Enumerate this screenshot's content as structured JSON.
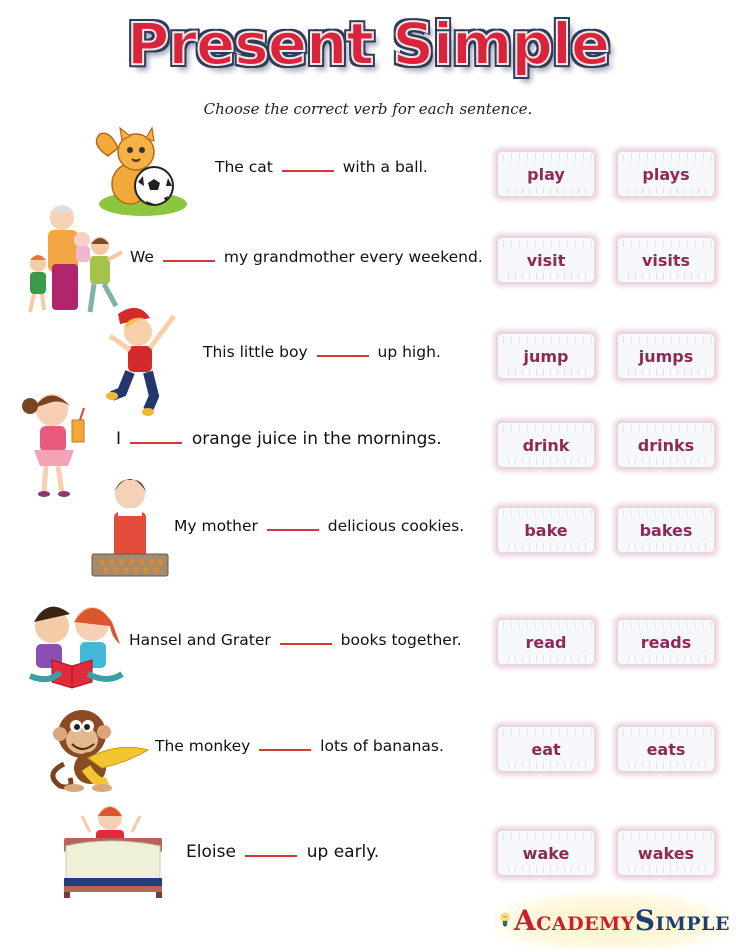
{
  "header": {
    "title": "Present Simple",
    "subtitle": "Choose the correct verb for each sentence."
  },
  "exercises": [
    {
      "before": "The cat",
      "after": "with a ball.",
      "options": [
        "play",
        "plays"
      ],
      "illustration": "cat-with-soccer-ball"
    },
    {
      "before": "We",
      "after": "my grandmother every weekend.",
      "options": [
        "visit",
        "visits"
      ],
      "illustration": "grandmother-with-children"
    },
    {
      "before": "This little boy",
      "after": "up high.",
      "options": [
        "jump",
        "jumps"
      ],
      "illustration": "boy-jumping"
    },
    {
      "before": "I",
      "after": "orange juice in the mornings.",
      "options": [
        "drink",
        "drinks"
      ],
      "illustration": "girl-drinking-juice"
    },
    {
      "before": "My mother",
      "after": "delicious cookies.",
      "options": [
        "bake",
        "bakes"
      ],
      "illustration": "mother-with-cookie-tray"
    },
    {
      "before": "Hansel and Grater",
      "after": "books together.",
      "options": [
        "read",
        "reads"
      ],
      "illustration": "children-reading-book"
    },
    {
      "before": "The monkey",
      "after": "lots of bananas.",
      "options": [
        "eat",
        "eats"
      ],
      "illustration": "monkey-with-banana"
    },
    {
      "before": "Eloise",
      "after": "up early.",
      "options": [
        "wake",
        "wakes"
      ],
      "illustration": "child-waking-in-bed"
    }
  ],
  "logo": {
    "part1_initial": "A",
    "part1_rest": "CADEMY",
    "part2_initial": "S",
    "part2_rest": "IMPLE"
  },
  "colors": {
    "title_red": "#d9243c",
    "title_outline": "#2e3d5c",
    "blank_line": "#d23a3a",
    "option_text": "#8e2a55"
  }
}
